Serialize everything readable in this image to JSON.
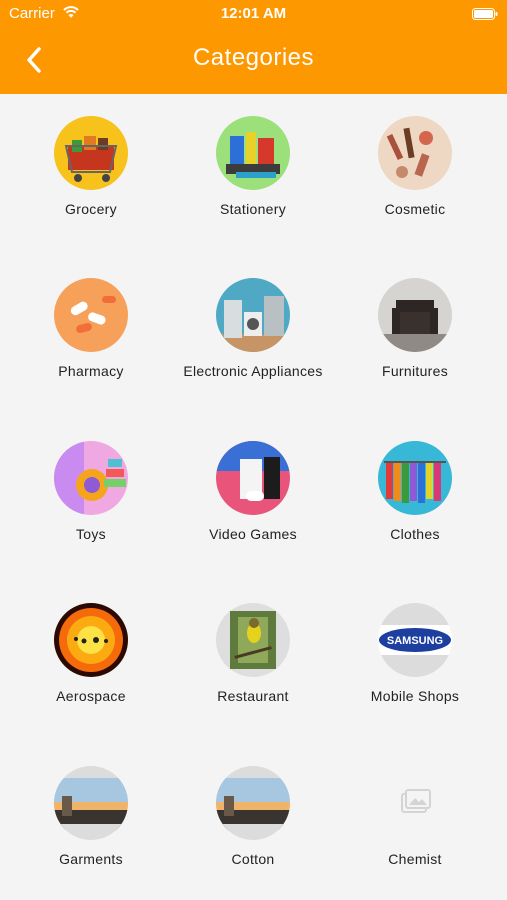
{
  "status": {
    "carrier": "Carrier",
    "time": "12:01 AM"
  },
  "nav": {
    "title": "Categories"
  },
  "categories": [
    {
      "label": "Grocery",
      "icon": "grocery-image"
    },
    {
      "label": "Stationery",
      "icon": "stationery-image"
    },
    {
      "label": "Cosmetic",
      "icon": "cosmetic-image"
    },
    {
      "label": "Pharmacy",
      "icon": "pharmacy-image"
    },
    {
      "label": "Electronic Appliances",
      "icon": "electronic-appliances-image"
    },
    {
      "label": "Furnitures",
      "icon": "furnitures-image"
    },
    {
      "label": "Toys",
      "icon": "toys-image"
    },
    {
      "label": "Video Games",
      "icon": "video-games-image"
    },
    {
      "label": "Clothes",
      "icon": "clothes-image"
    },
    {
      "label": "Aerospace",
      "icon": "aerospace-image"
    },
    {
      "label": "Restaurant",
      "icon": "restaurant-image"
    },
    {
      "label": "Mobile Shops",
      "icon": "mobile-shops-image"
    },
    {
      "label": "Garments",
      "icon": "garments-image"
    },
    {
      "label": "Cotton",
      "icon": "cotton-image"
    },
    {
      "label": "Chemist",
      "icon": "placeholder-image"
    }
  ],
  "brand_text": {
    "samsung_logo": "SAMSUNG"
  },
  "colors": {
    "accent": "#fd9800",
    "background": "#f4f4f4"
  }
}
